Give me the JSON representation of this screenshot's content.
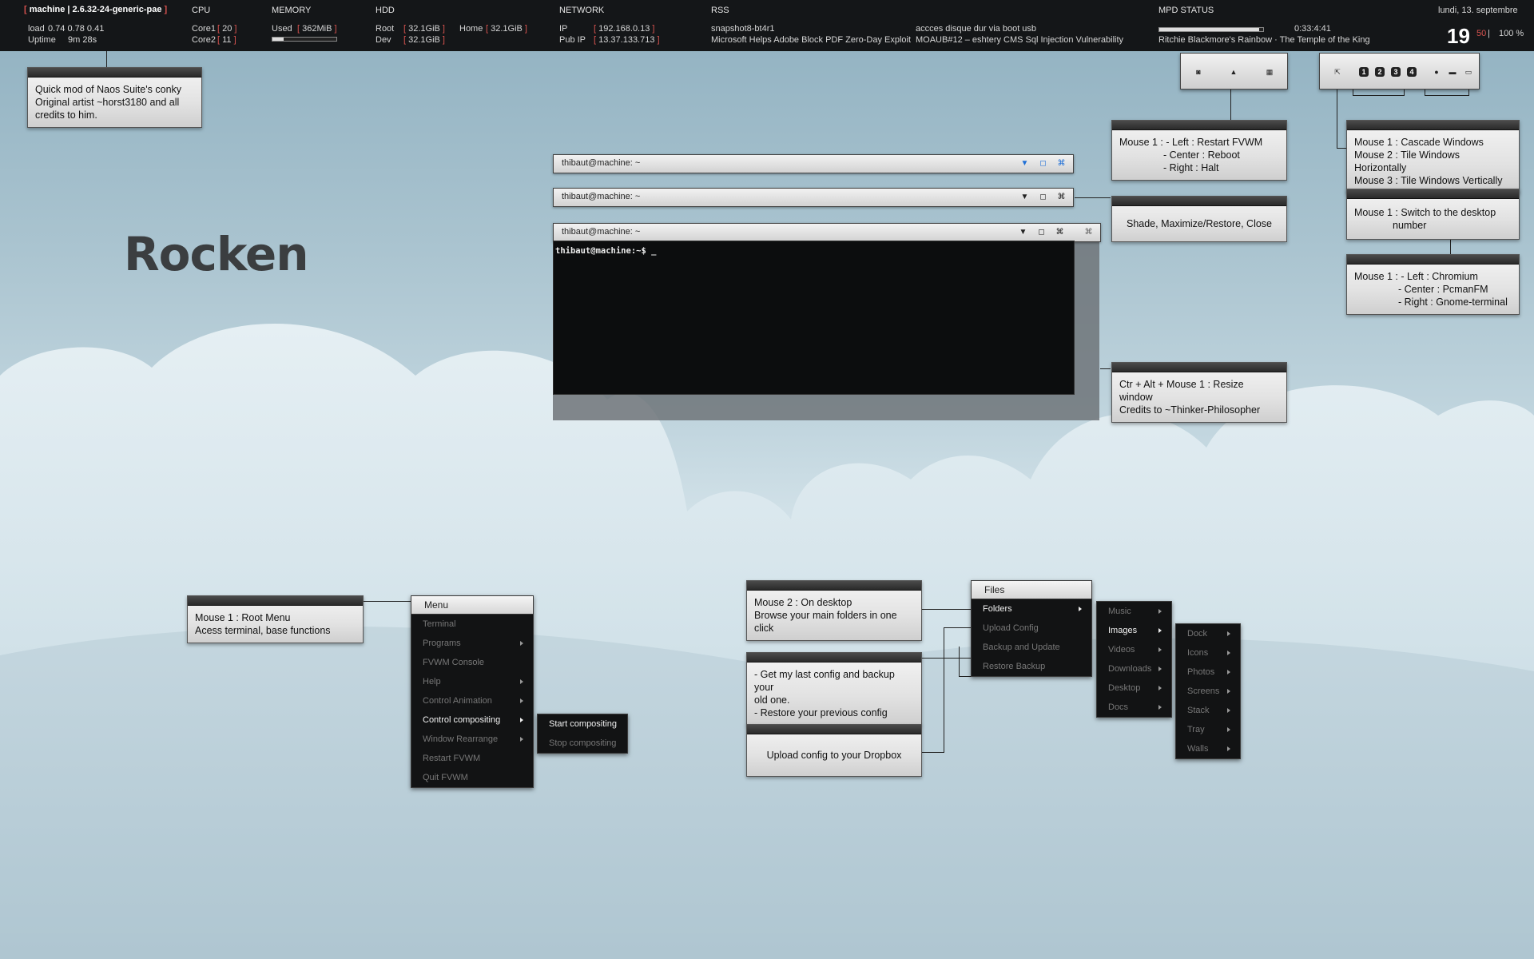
{
  "topbar": {
    "machine": "machine | 2.6.32-24-generic-pae",
    "load_label": "load",
    "load_value": "0.74 0.78 0.41",
    "uptime_label": "Uptime",
    "uptime_value": "9m 28s",
    "cpu": {
      "header": "CPU",
      "core1_label": "Core1",
      "core1_value": "20",
      "core2_label": "Core2",
      "core2_value": "11"
    },
    "memory": {
      "header": "MEMORY",
      "used_label": "Used",
      "used_value": "362MiB",
      "used_fraction": 0.18
    },
    "hdd": {
      "header": "HDD",
      "root_label": "Root",
      "root_value": "32.1GiB",
      "home_label": "Home",
      "home_value": "32.1GiB",
      "dev_label": "Dev",
      "dev_value": "32.1GiB"
    },
    "network": {
      "header": "NETWORK",
      "ip_label": "IP",
      "ip_value": "192.168.0.13",
      "pubip_label": "Pub IP",
      "pubip_value": "13.37.133.713"
    },
    "rss": {
      "header": "RSS",
      "items": [
        "snapshot8-bt4r1",
        "Microsoft Helps Adobe Block PDF Zero-Day Exploit",
        "accces disque dur via boot usb",
        "MOAUB#12 – eshtery CMS Sql Injection Vulnerability"
      ]
    },
    "mpd": {
      "header": "MPD STATUS",
      "time": "0:33:4:41",
      "track": "Ritchie Blackmore's Rainbow · The Temple of the King",
      "progress": 0.96
    },
    "date": "lundi, 13. septembre",
    "day": "19",
    "day_small": "50",
    "volume": "100 %"
  },
  "title": "Rocken",
  "notes": {
    "credits": [
      "Quick mod of Naos Suite's conky",
      "Original artist ~horst3180 and all",
      "credits to him."
    ],
    "restart": [
      "Mouse 1 : - Left : Restart FVWM",
      "- Center : Reboot",
      "- Right : Halt"
    ],
    "cascade": [
      "Mouse 1 : Cascade Windows",
      "Mouse 2 : Tile Windows Horizontally",
      "Mouse 3 : Tile Windows Vertically"
    ],
    "switch": [
      "Mouse 1 : Switch to the desktop",
      "number"
    ],
    "launch": [
      "Mouse 1 : - Left : Chromium",
      "- Center : PcmanFM",
      "- Right : Gnome-terminal"
    ],
    "shade": "Shade, Maximize/Restore, Close",
    "resize": [
      "Ctr + Alt + Mouse 1 : Resize window",
      "Credits to ~Thinker-Philosopher"
    ],
    "rootmenu": [
      "Mouse 1 : Root Menu",
      "Acess terminal, base functions"
    ],
    "desktop": [
      "Mouse 2 : On desktop",
      "Browse your main folders in one click"
    ],
    "config": [
      "- Get my last config and backup your",
      "old one.",
      "- Restore your previous config"
    ],
    "dropbox": "Upload config to your Dropbox"
  },
  "windows": [
    {
      "title": "thibaut@machine: ~"
    },
    {
      "title": "thibaut@machine: ~"
    },
    {
      "title": "thibaut@machine: ~",
      "prompt": "thibaut@machine:~$ _"
    }
  ],
  "workspaces": [
    "1",
    "2",
    "3",
    "4"
  ],
  "root_menu": {
    "title": "Menu",
    "items": [
      "Terminal",
      "Programs",
      "FVWM Console",
      "Help",
      "Control Animation",
      "Control compositing",
      "Window Rearrange",
      "Restart FVWM",
      "Quit FVWM"
    ],
    "submenu": [
      "Start compositing",
      "Stop compositing"
    ]
  },
  "files_menu": {
    "title": "Files",
    "items": [
      "Folders",
      "Upload Config",
      "Backup and Update",
      "Restore Backup"
    ],
    "folders": [
      "Music",
      "Images",
      "Videos",
      "Downloads",
      "Desktop",
      "Docs"
    ],
    "images": [
      "Dock",
      "Icons",
      "Photos",
      "Screens",
      "Stack",
      "Tray",
      "Walls"
    ]
  },
  "colors": {
    "topbar": "#141618",
    "accent_red": "#d9534f",
    "menu_bg": "#121314",
    "window_btn": "#1f6fd6"
  }
}
